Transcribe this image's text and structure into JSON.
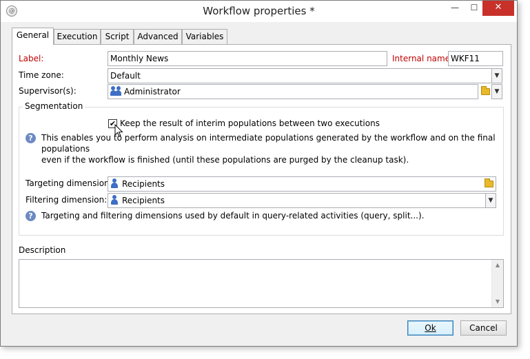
{
  "window": {
    "title": "Workflow properties *",
    "app_icon_glyph": "@",
    "minimize_glyph": "—",
    "maximize_glyph": "☐",
    "close_glyph": "✕"
  },
  "tabs": [
    {
      "label": "General",
      "active": true
    },
    {
      "label": "Execution",
      "active": false
    },
    {
      "label": "Script",
      "active": false
    },
    {
      "label": "Advanced",
      "active": false
    },
    {
      "label": "Variables",
      "active": false
    }
  ],
  "general": {
    "label_caption": "Label:",
    "label_value": "Monthly News",
    "internal_name_caption": "Internal name:",
    "internal_name_value": "WKF11",
    "timezone_caption": "Time zone:",
    "timezone_value": "Default",
    "supervisor_caption": "Supervisor(s):",
    "supervisor_value": "Administrator"
  },
  "segmentation": {
    "title": "Segmentation",
    "keep_checkbox_label": "Keep the result of interim populations between two executions",
    "keep_checked": true,
    "check_glyph": "✔",
    "help_text_1": "This enables you to perform analysis on intermediate populations generated by the workflow and on the final populations",
    "help_text_2": "even if the workflow is finished (until these populations are purged by the cleanup task).",
    "targeting_caption": "Targeting dimension:",
    "targeting_value": "Recipients",
    "filtering_caption": "Filtering dimension:",
    "filtering_value": "Recipients",
    "dimensions_help": "Targeting and filtering dimensions used by default in query-related activities (query, split...)."
  },
  "description": {
    "title": "Description",
    "value": ""
  },
  "buttons": {
    "ok_label": "Ok",
    "cancel_label": "Cancel"
  },
  "glyphs": {
    "dropdown": "▼",
    "scroll_up": "▲",
    "scroll_down": "▼",
    "help": "?"
  },
  "colors": {
    "required_label": "#c00000",
    "close_button": "#c7312a",
    "user_icon": "#3d6fc6",
    "folder_icon": "#e8b92a",
    "help_icon": "#6d8ac2"
  }
}
